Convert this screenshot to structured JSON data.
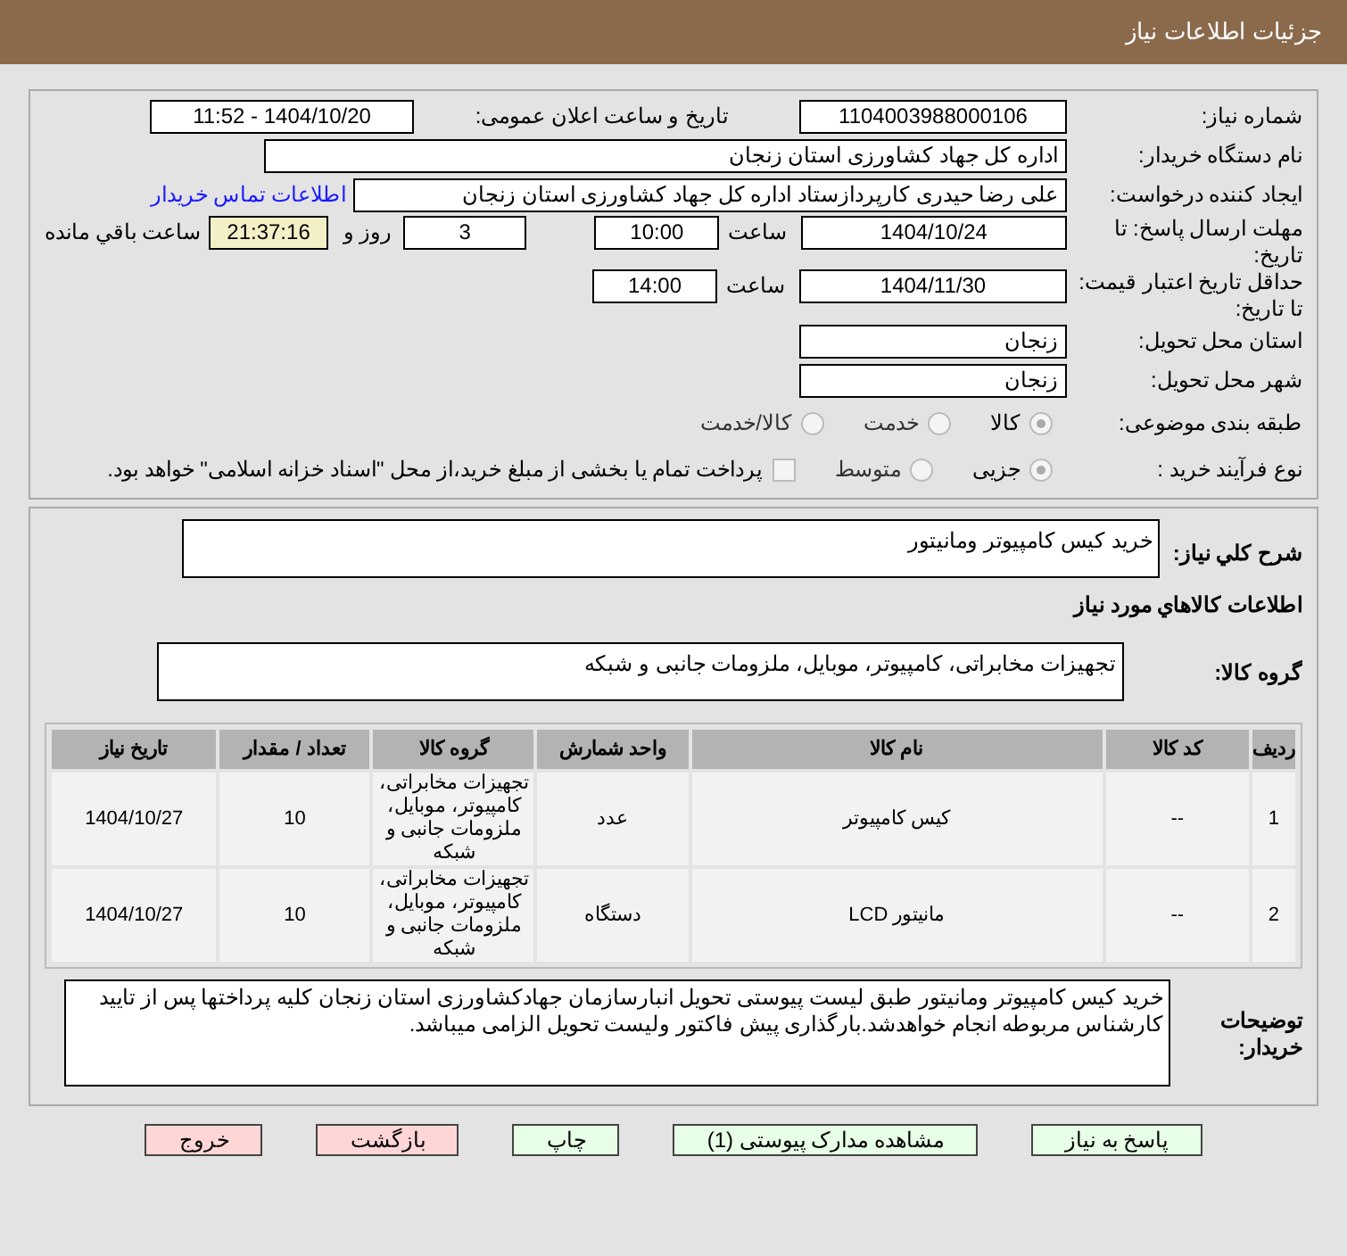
{
  "header": {
    "title": "جزئیات اطلاعات نیاز"
  },
  "info": {
    "need_number": {
      "label": "شماره نیاز:",
      "value": "1104003988000106"
    },
    "announce": {
      "label": "تاریخ و ساعت اعلان عمومی:",
      "value": "1404/10/20 - 11:52"
    },
    "buyer": {
      "label": "نام دستگاه خریدار:",
      "value": "اداره کل جهاد کشاورزی استان زنجان"
    },
    "creator": {
      "label": "ایجاد کننده درخواست:",
      "value": "علی رضا حیدری کارپردازستاد اداره کل جهاد کشاورزی استان زنجان",
      "link": "اطلاعات تماس خریدار"
    },
    "deadline": {
      "label": "مهلت ارسال پاسخ: تا تاریخ:",
      "date": "1404/10/24",
      "time_label": "ساعت",
      "time": "10:00",
      "days": "3",
      "days_label": "روز و",
      "remaining": "21:37:16",
      "remaining_label": "ساعت باقي مانده"
    },
    "validity": {
      "label": "حداقل تاریخ اعتبار قیمت: تا تاریخ:",
      "date": "1404/11/30",
      "time_label": "ساعت",
      "time": "14:00"
    },
    "province": {
      "label": "استان محل تحویل:",
      "value": "زنجان"
    },
    "city": {
      "label": "شهر محل تحویل:",
      "value": "زنجان"
    },
    "category": {
      "label": "طبقه بندی موضوعی:",
      "options": [
        {
          "label": "کالا",
          "selected": true
        },
        {
          "label": "خدمت",
          "selected": false
        },
        {
          "label": "کالا/خدمت",
          "selected": false
        }
      ]
    },
    "process": {
      "label": "نوع فرآیند خرید :",
      "options": [
        {
          "label": "جزیی",
          "selected": true
        },
        {
          "label": "متوسط",
          "selected": false
        }
      ],
      "payment": {
        "checked": false,
        "text": "پرداخت تمام یا بخشی از مبلغ خرید،از محل \"اسناد خزانه اسلامی\" خواهد بود."
      }
    }
  },
  "goods": {
    "summary": {
      "label": "شرح کلي نياز:",
      "value": "خرید کیس کامپیوتر ومانیتور"
    },
    "section_title": "اطلاعات كالاهاي مورد نياز",
    "group": {
      "label": "گروه کالا:",
      "value": "تجهیزات مخابراتی، کامپیوتر، موبایل، ملزومات جانبی و شبکه"
    },
    "table": {
      "columns": [
        "رديف",
        "کد کالا",
        "نام کالا",
        "واحد شمارش",
        "گروه کالا",
        "تعداد / مقدار",
        "تاریخ نیاز"
      ],
      "rows": [
        [
          "1",
          "--",
          "کیس کامپیوتر",
          "عدد",
          "تجهیزات مخابراتی، کامپیوتر، موبایل، ملزومات جانبی و شبکه",
          "10",
          "1404/10/27"
        ],
        [
          "2",
          "--",
          "مانیتور LCD",
          "دستگاه",
          "تجهیزات مخابراتی، کامپیوتر، موبایل، ملزومات جانبی و شبکه",
          "10",
          "1404/10/27"
        ]
      ]
    },
    "notes": {
      "label": "توضیحات خریدار:",
      "value": "خرید کیس کامپیوتر ومانیتور  طبق لیست پیوستی تحویل انبارسازمان جهادکشاورزی استان زنجان کلیه پرداختها پس از تایید کارشناس مربوطه انجام خواهدشد.بارگذاری پیش فاکتور ولیست تحویل الزامی میباشد."
    }
  },
  "buttons": [
    {
      "label": "پاسخ به نیاز",
      "kind": "green"
    },
    {
      "label": "مشاهده مدارک پیوستی (1)",
      "kind": "green"
    },
    {
      "label": "چاپ",
      "kind": "green"
    },
    {
      "label": "بازگشت",
      "kind": "red"
    },
    {
      "label": "خروج",
      "kind": "red"
    }
  ]
}
